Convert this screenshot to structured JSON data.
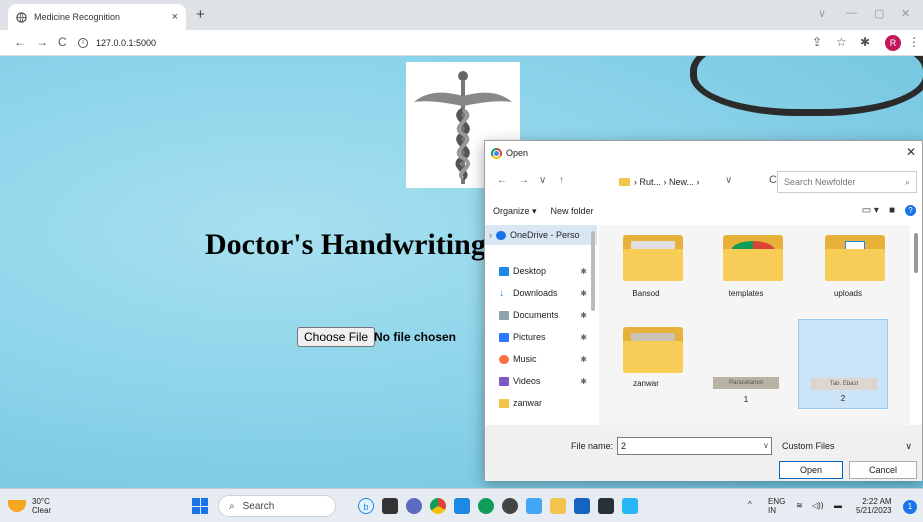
{
  "browser": {
    "tab_title": "Medicine Recognition",
    "tab_close": "×",
    "new_tab": "+",
    "url": "127.0.0.1:5000",
    "avatar_letter": "R",
    "window_controls": [
      "∨",
      "—",
      "▢",
      "✕"
    ]
  },
  "page": {
    "heading": "Doctor's Handwriting Recognition",
    "choose_file_label": "Choose File",
    "file_status": "No file chosen"
  },
  "dialog": {
    "title": "Open",
    "breadcrumb": "› Rut... › New... ›",
    "search_placeholder": "Search Newfolder",
    "organize_label": "Organize ▾",
    "new_folder_label": "New folder",
    "nav_items": [
      {
        "label": "OneDrive - Perso",
        "icon": "cloud-icon"
      },
      {
        "label": "Desktop",
        "icon": "desktop-icon"
      },
      {
        "label": "Downloads",
        "icon": "download-icon"
      },
      {
        "label": "Documents",
        "icon": "documents-icon"
      },
      {
        "label": "Pictures",
        "icon": "pictures-icon"
      },
      {
        "label": "Music",
        "icon": "music-icon"
      },
      {
        "label": "Videos",
        "icon": "videos-icon"
      },
      {
        "label": "zanwar",
        "icon": "folder-icon"
      }
    ],
    "files": [
      {
        "name": "Bansod",
        "kind": "folder"
      },
      {
        "name": "templates",
        "kind": "folder"
      },
      {
        "name": "uploads",
        "kind": "folder"
      },
      {
        "name": "zanwar",
        "kind": "folder"
      },
      {
        "name": "1",
        "kind": "image",
        "thumb_text": "Paracetamol"
      },
      {
        "name": "2",
        "kind": "image",
        "thumb_text": "Tab. Ebast",
        "selected": true
      }
    ],
    "file_name_label": "File name:",
    "file_name_value": "2",
    "file_type": "Custom Files",
    "open_button": "Open",
    "cancel_button": "Cancel"
  },
  "taskbar": {
    "temperature": "30°C",
    "weather": "Clear",
    "search_label": "Search",
    "lang_top": "ENG",
    "lang_bottom": "IN",
    "time": "2:22 AM",
    "date": "5/21/2023",
    "notification_count": "1"
  }
}
